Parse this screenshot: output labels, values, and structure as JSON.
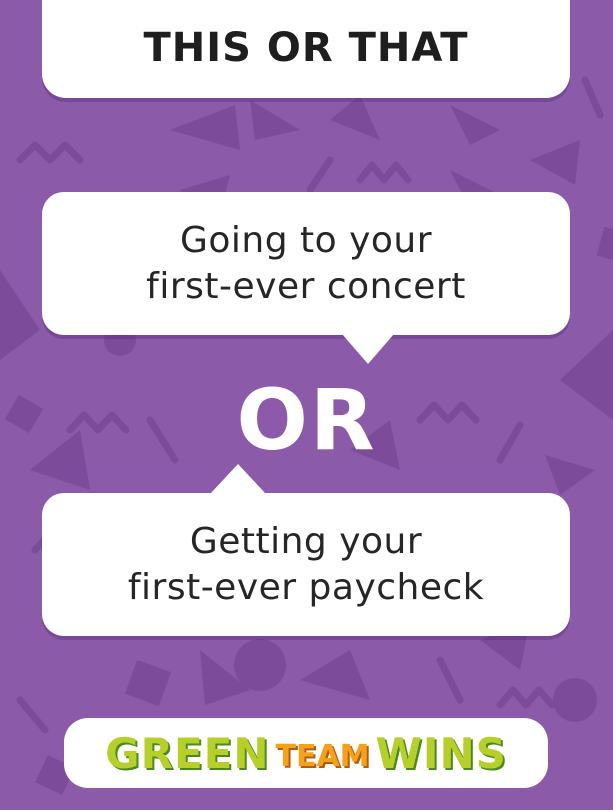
{
  "card": {
    "title": "THIS OR THAT",
    "option_a": [
      "Going to your",
      "first-ever concert"
    ],
    "separator": "OR",
    "option_b": [
      "Getting your",
      "first-ever paycheck"
    ]
  },
  "branding": {
    "logo_words": [
      "GREEN",
      "TEAM",
      "WINS"
    ]
  },
  "colors": {
    "background": "#8b5aa9",
    "pattern": "#7d4e9c",
    "card": "#ffffff",
    "text": "#262626",
    "logo_green": "#b7cf2a",
    "logo_orange": "#f5a11c"
  }
}
